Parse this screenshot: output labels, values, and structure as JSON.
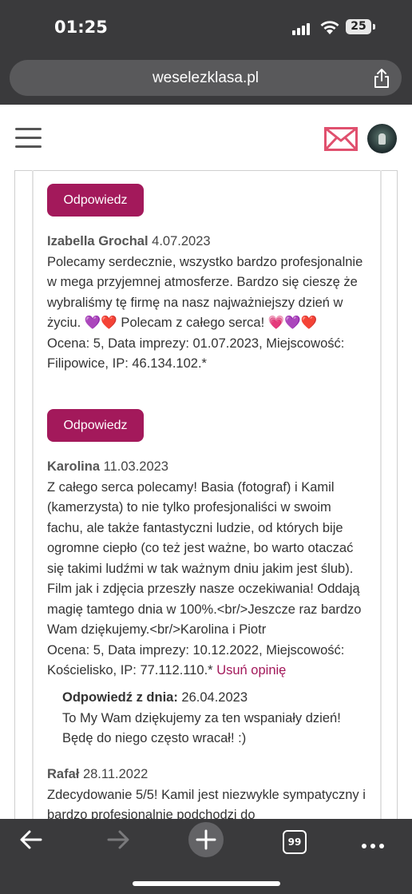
{
  "status_bar": {
    "time": "01:25",
    "battery": "25"
  },
  "browser": {
    "url": "weselezklasa.pl",
    "tabs_count": "99"
  },
  "reviews": [
    {
      "reply_button": "Odpowiedz",
      "author": "Izabella Grochal",
      "date": "4.07.2023",
      "text": "Polecamy serdecznie, wszystko bardzo profesjonalnie w mega przyjemnej atmosferze. Bardzo się cieszę że wybraliśmy tę firmę na nasz najważniejszy dzień w życiu. 💜❤️ Polecam z całego serca! 💗💜❤️",
      "meta": "Ocena: 5, Data imprezy: 01.07.2023, Miejscowość: Filipowice, IP: 46.134.102.*"
    },
    {
      "reply_button": "Odpowiedz",
      "author": "Karolina",
      "date": "11.03.2023",
      "text": "Z całego serca polecamy! Basia (fotograf) i Kamil (kamerzysta) to nie tylko profesjonaliści w swoim fachu, ale także fantastyczni ludzie, od których bije ogromne ciepło (co też jest ważne, bo warto otaczać się takimi ludźmi w tak ważnym dniu jakim jest ślub). Film jak i zdjęcia przeszły nasze oczekiwania! Oddają magię tamtego dnia w 100%.<br/>Jeszcze raz bardzo Wam dziękujemy.<br/>Karolina i Piotr",
      "meta": "Ocena: 5, Data imprezy: 10.12.2022, Miejscowość: Kościelisko, IP: 77.112.110.*",
      "delete_link": "Usuń opinię",
      "answer": {
        "label": "Odpowiedź z dnia:",
        "date": "26.04.2023",
        "text": "To My Wam dziękujemy za ten wspaniały dzień! Będę do niego często wracał! :)"
      }
    },
    {
      "author": "Rafał",
      "date": "28.11.2022",
      "text": "Zdecydowanie 5/5! Kamil jest niezwykle sympatyczny i bardzo profesjonalnie podchodzi do"
    }
  ],
  "icons": [
    "menu-icon",
    "mail-icon",
    "avatar",
    "share-icon",
    "back-icon",
    "forward-icon",
    "plus-icon",
    "tabs-icon",
    "more-icon"
  ],
  "colors": {
    "accent": "#a3195b",
    "mail_icon": "#e0506e",
    "chrome": "#3a3a3c"
  }
}
